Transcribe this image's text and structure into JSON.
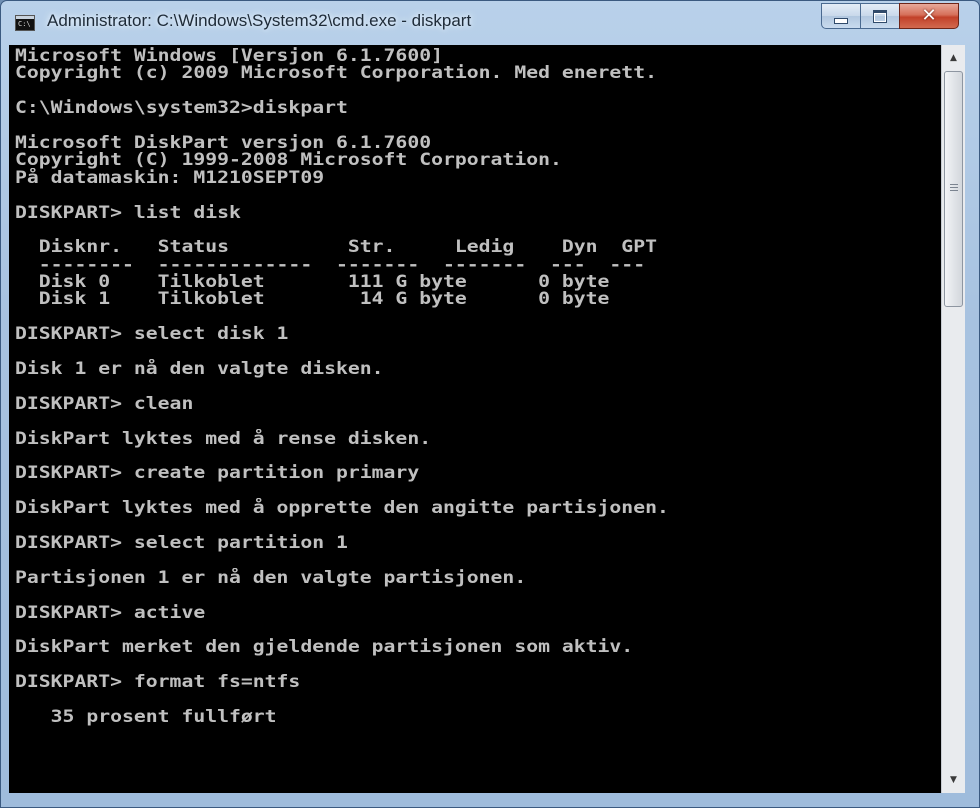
{
  "window": {
    "title": "Administrator: C:\\Windows\\System32\\cmd.exe - diskpart",
    "icon": "cmd-icon",
    "icon_text": "C:\\"
  },
  "caption_buttons": {
    "minimize_icon": "minimize-icon",
    "maximize_icon": "maximize-icon",
    "close_icon": "close-icon"
  },
  "colors": {
    "console_background": "#000000",
    "console_text": "#c0c0c0",
    "close_button": "#c2412a"
  },
  "console": {
    "lines": [
      "Microsoft Windows [Versjon 6.1.7600]",
      "Copyright (c) 2009 Microsoft Corporation. Med enerett.",
      "",
      "C:\\Windows\\system32>diskpart",
      "",
      "Microsoft DiskPart versjon 6.1.7600",
      "Copyright (C) 1999-2008 Microsoft Corporation.",
      "På datamaskin: M1210SEPT09",
      "",
      "DISKPART> list disk",
      "",
      "  Disknr.   Status          Str.     Ledig    Dyn  GPT",
      "  --------  -------------  -------  -------  ---  ---",
      "  Disk 0    Tilkoblet       111 G byte      0 byte",
      "  Disk 1    Tilkoblet        14 G byte      0 byte",
      "",
      "DISKPART> select disk 1",
      "",
      "Disk 1 er nå den valgte disken.",
      "",
      "DISKPART> clean",
      "",
      "DiskPart lyktes med å rense disken.",
      "",
      "DISKPART> create partition primary",
      "",
      "DiskPart lyktes med å opprette den angitte partisjonen.",
      "",
      "DISKPART> select partition 1",
      "",
      "Partisjonen 1 er nå den valgte partisjonen.",
      "",
      "DISKPART> active",
      "",
      "DiskPart merket den gjeldende partisjonen som aktiv.",
      "",
      "DISKPART> format fs=ntfs",
      "",
      "   35 prosent fullført"
    ]
  },
  "scrollbar": {
    "up_icon": "scroll-up-arrow-icon",
    "down_icon": "scroll-down-arrow-icon",
    "up_glyph": "▲",
    "down_glyph": "▼"
  }
}
